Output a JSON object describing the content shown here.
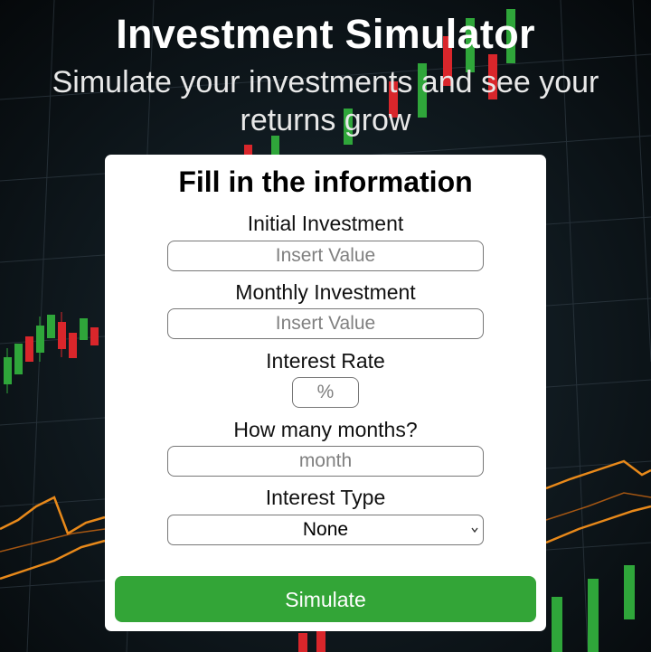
{
  "header": {
    "title": "Investment Simulator",
    "subtitle": "Simulate your investments and see your returns grow"
  },
  "form": {
    "heading": "Fill in the information",
    "initial_investment": {
      "label": "Initial Investment",
      "placeholder": "Insert Value",
      "value": ""
    },
    "monthly_investment": {
      "label": "Monthly Investment",
      "placeholder": "Insert Value",
      "value": ""
    },
    "interest_rate": {
      "label": "Interest Rate",
      "placeholder": "%",
      "value": ""
    },
    "months": {
      "label": "How many months?",
      "placeholder": "month",
      "value": ""
    },
    "interest_type": {
      "label": "Interest Type",
      "selected": "None"
    },
    "submit_label": "Simulate"
  },
  "colors": {
    "background": "#0b0f12",
    "candle_up": "#2fa63a",
    "candle_down": "#d9262b",
    "line_orange": "#e8891a",
    "button": "#33a537",
    "card": "#ffffff"
  }
}
